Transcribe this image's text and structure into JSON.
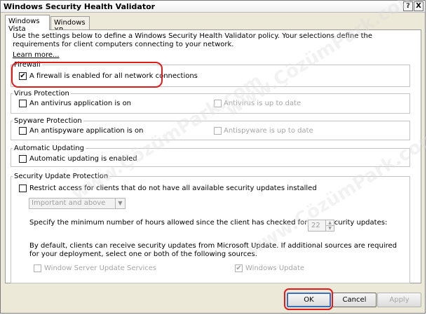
{
  "window": {
    "title": "Windows Security Health Validator",
    "help_glyph": "?",
    "close_glyph": "X"
  },
  "tabs": [
    {
      "label": "Windows Vista"
    },
    {
      "label": "Windows XP"
    }
  ],
  "intro": {
    "text": "Use the settings below to define a Windows Security Health Validator policy. Your selections define the requirements for client computers connecting to your network.",
    "learn_more": "Learn more..."
  },
  "firewall": {
    "legend": "Firewall",
    "checkbox_label": "A firewall is enabled for all network connections",
    "checked": true
  },
  "virus": {
    "legend": "Virus Protection",
    "primary_label": "An antivirus application is on",
    "secondary_label": "Antivirus is up to date"
  },
  "spyware": {
    "legend": "Spyware Protection",
    "primary_label": "An antispyware application is on",
    "secondary_label": "Antispyware is up to date"
  },
  "updating": {
    "legend": "Automatic Updating",
    "checkbox_label": "Automatic updating is enabled"
  },
  "security_updates": {
    "legend": "Security Update Protection",
    "restrict_label": "Restrict access for clients that do not have all available security updates installed",
    "severity_value": "Important and above",
    "hours_text": "Specify the minimum number of hours allowed since the client has checked for new security updates:",
    "hours_value": "22",
    "sources_text": "By default, clients can receive security updates from Microsoft Update.  If additional sources are required for your deployment, select one or both of the following sources.",
    "wsus_label": "Window Server Update Services",
    "windows_update_label": "Windows Update"
  },
  "buttons": {
    "ok": "OK",
    "cancel": "Cancel",
    "apply": "Apply"
  },
  "watermark": "www.ÇözümPark.com",
  "colors": {
    "highlight": "#e01b1b",
    "dialog_bg": "#ece9d8"
  }
}
